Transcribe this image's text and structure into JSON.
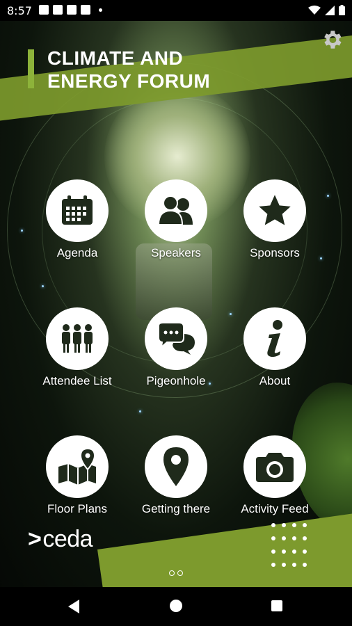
{
  "status_bar": {
    "time": "8:57"
  },
  "app": {
    "title_line1": "CLIMATE AND",
    "title_line2": "ENERGY FORUM",
    "logo_text": "ceda"
  },
  "tiles": [
    {
      "label": "Agenda",
      "icon": "calendar-icon"
    },
    {
      "label": "Speakers",
      "icon": "people-icon"
    },
    {
      "label": "Sponsors",
      "icon": "star-icon"
    },
    {
      "label": "Attendee List",
      "icon": "attendees-icon"
    },
    {
      "label": "Pigeonhole",
      "icon": "chat-bubbles-icon"
    },
    {
      "label": "About",
      "icon": "info-icon"
    },
    {
      "label": "Floor Plans",
      "icon": "map-icon"
    },
    {
      "label": "Getting there",
      "icon": "location-pin-icon"
    },
    {
      "label": "Activity Feed",
      "icon": "camera-icon"
    }
  ],
  "colors": {
    "accent_green": "#8db33a",
    "band_green": "#7d9a2d",
    "icon_dark": "#1f2a1b"
  }
}
